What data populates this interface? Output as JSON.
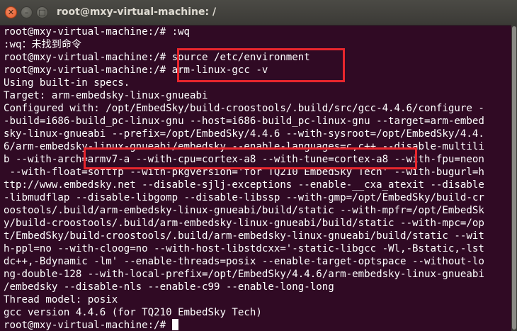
{
  "window": {
    "title": "root@mxy-virtual-machine: /",
    "close_glyph": "✕",
    "minimize_glyph": "–",
    "maximize_glyph": "□"
  },
  "terminal": {
    "lines": [
      "root@mxy-virtual-machine:/# :wq",
      ":wq：未找到命令",
      "root@mxy-virtual-machine:/# source /etc/environment",
      "root@mxy-virtual-machine:/# arm-linux-gcc -v",
      "Using built-in specs.",
      "Target: arm-embedsky-linux-gnueabi",
      "Configured with: /opt/EmbedSky/build-croostools/.build/src/gcc-4.4.6/configure -",
      "-build=i686-build_pc-linux-gnu --host=i686-build_pc-linux-gnu --target=arm-embed",
      "sky-linux-gnueabi --prefix=/opt/EmbedSky/4.4.6 --with-sysroot=/opt/EmbedSky/4.4.",
      "6/arm-embedsky-linux-gnueabi/embedsky --enable-languages=c,c++ --disable-multili",
      "b --with-arch=armv7-a --with-cpu=cortex-a8 --with-tune=cortex-a8 --with-fpu=neon",
      " --with-float=softfp --with-pkgversion='for TQ210 EmbedSky Tech' --with-bugurl=h",
      "ttp://www.embedsky.net --disable-sjlj-exceptions --enable-__cxa_atexit --disable",
      "-libmudflap --disable-libgomp --disable-libssp --with-gmp=/opt/EmbedSky/build-cr",
      "oostools/.build/arm-embedsky-linux-gnueabi/build/static --with-mpfr=/opt/EmbedSk",
      "y/build-croostools/.build/arm-embedsky-linux-gnueabi/build/static --with-mpc=/op",
      "t/EmbedSky/build-croostools/.build/arm-embedsky-linux-gnueabi/build/static --wit",
      "h-ppl=no --with-cloog=no --with-host-libstdcxx='-static-libgcc -Wl,-Bstatic,-lst",
      "dc++,-Bdynamic -lm' --enable-threads=posix --enable-target-optspace --without-lo",
      "ng-double-128 --with-local-prefix=/opt/EmbedSky/4.4.6/arm-embedsky-linux-gnueabi",
      "/embedsky --disable-nls --enable-c99 --enable-long-long",
      "Thread model: posix",
      "gcc version 4.4.6 (for TQ210 EmbedSky Tech)",
      "root@mxy-virtual-machine:/# "
    ]
  },
  "colors": {
    "background": "#300a24",
    "text": "#ffffff",
    "highlight": "#e8262d"
  }
}
